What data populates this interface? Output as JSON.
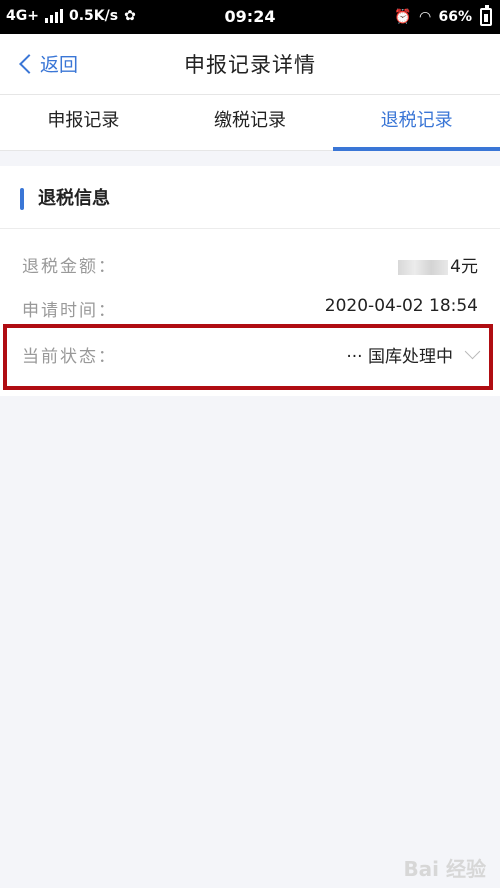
{
  "status_bar": {
    "network": "4G+",
    "speed": "0.5K/s",
    "time": "09:24",
    "battery": "66%"
  },
  "nav": {
    "back_label": "返回",
    "title": "申报记录详情"
  },
  "tabs": [
    {
      "label": "申报记录"
    },
    {
      "label": "缴税记录"
    },
    {
      "label": "退税记录"
    }
  ],
  "section": {
    "title": "退税信息",
    "rows": [
      {
        "label": "退税金额：",
        "value": "4元"
      },
      {
        "label": "申请时间：",
        "value": "2020-04-02 18:54"
      },
      {
        "label": "当前状态：",
        "value": "··· 国库处理中"
      }
    ]
  },
  "watermark": "Bai 经验"
}
